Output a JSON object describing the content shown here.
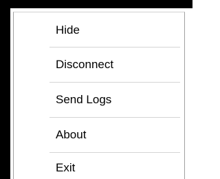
{
  "context_menu": {
    "items": [
      {
        "label": "Hide"
      },
      {
        "label": "Disconnect"
      },
      {
        "label": "Send Logs"
      },
      {
        "label": "About"
      },
      {
        "label": "Exit"
      }
    ]
  },
  "colors": {
    "menu_background": "#ffffff",
    "text": "#000000",
    "separator": "#d4d4d4",
    "border": "#a0a0a0",
    "window_edge": "#000000"
  }
}
